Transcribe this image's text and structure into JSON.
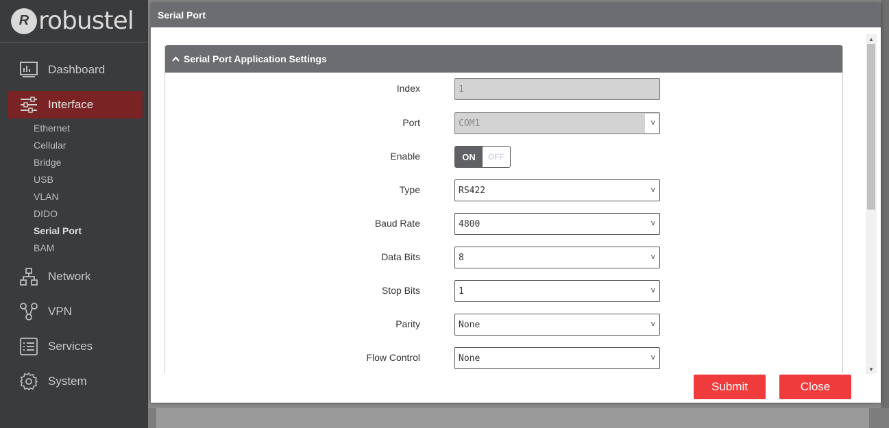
{
  "brand": {
    "logo_text": "robustel"
  },
  "sidebar": {
    "items": [
      {
        "label": "Dashboard",
        "icon": "dashboard-icon"
      },
      {
        "label": "Interface",
        "icon": "sliders-icon"
      },
      {
        "label": "Network",
        "icon": "network-icon"
      },
      {
        "label": "VPN",
        "icon": "vpn-icon"
      },
      {
        "label": "Services",
        "icon": "services-icon"
      },
      {
        "label": "System",
        "icon": "gear-icon"
      }
    ],
    "sub_items": [
      "Ethernet",
      "Cellular",
      "Bridge",
      "USB",
      "VLAN",
      "DIDO",
      "Serial Port",
      "BAM"
    ],
    "active_item": "Interface",
    "current_sub": "Serial Port"
  },
  "modal": {
    "title": "Serial Port",
    "section_title": "Serial Port Application Settings",
    "fields": {
      "index": {
        "label": "Index",
        "value": "1"
      },
      "port": {
        "label": "Port",
        "value": "COM1"
      },
      "enable": {
        "label": "Enable",
        "on": "ON",
        "off": "OFF"
      },
      "type": {
        "label": "Type",
        "value": "RS422"
      },
      "baud_rate": {
        "label": "Baud Rate",
        "value": "4800"
      },
      "data_bits": {
        "label": "Data Bits",
        "value": "8"
      },
      "stop_bits": {
        "label": "Stop Bits",
        "value": "1"
      },
      "parity": {
        "label": "Parity",
        "value": "None"
      },
      "flow_control": {
        "label": "Flow Control",
        "value": "None"
      }
    },
    "submit_label": "Submit",
    "close_label": "Close"
  },
  "colors": {
    "accent": "#ef3b3b",
    "header": "#6b6d70",
    "sidebar": "#3a3b3d",
    "active": "#7a2324"
  }
}
